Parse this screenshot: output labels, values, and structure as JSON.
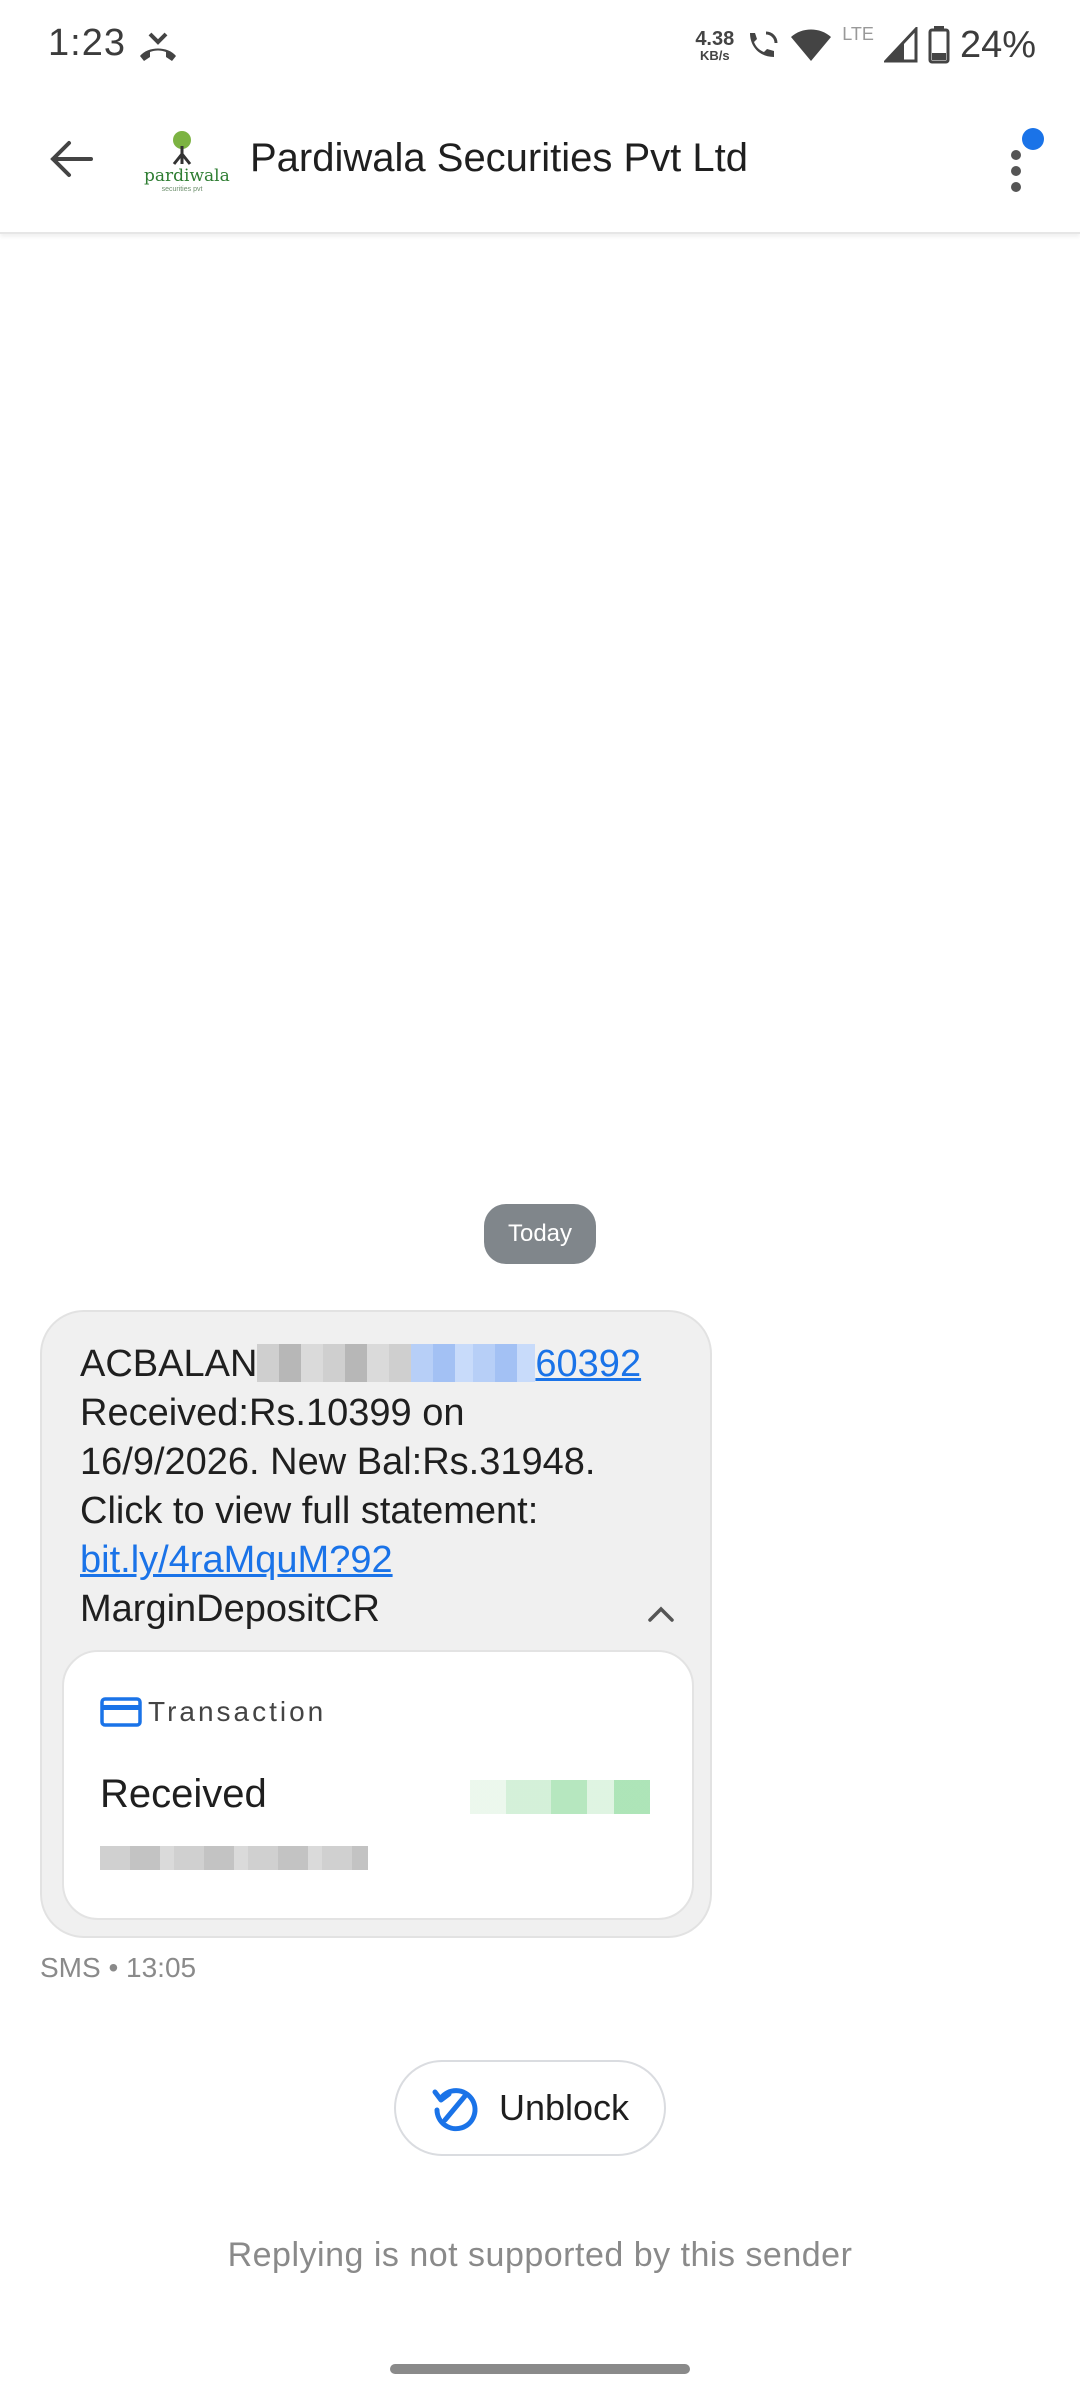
{
  "status_bar": {
    "time": "1:23",
    "net_speed_value": "4.38",
    "net_speed_unit": "KB/s",
    "network_type": "LTE",
    "battery": "24%"
  },
  "app_bar": {
    "title": "Pardiwala Securities Pvt Ltd",
    "avatar_text": "pardiwala",
    "avatar_subtext": "securities pvt"
  },
  "conversation": {
    "date_chip": "Today",
    "message": {
      "line1_prefix": "ACBALAN",
      "line1_link_suffix": "60392",
      "line2": "Received:Rs.10399 on",
      "line3": "16/9/2026. New Bal:Rs.31948.",
      "line4": "Click to view full statement:",
      "link": "bit.ly/4raMquM?92",
      "line6": "MarginDepositCR"
    },
    "card": {
      "header": "Transaction",
      "status": "Received"
    },
    "meta": "SMS • 13:05"
  },
  "unblock_label": "Unblock",
  "reply_note": "Replying is not supported by this sender",
  "colors": {
    "accent": "#1a73e8",
    "bubble_bg": "#f0f0f0",
    "chip_bg": "#80868b"
  }
}
